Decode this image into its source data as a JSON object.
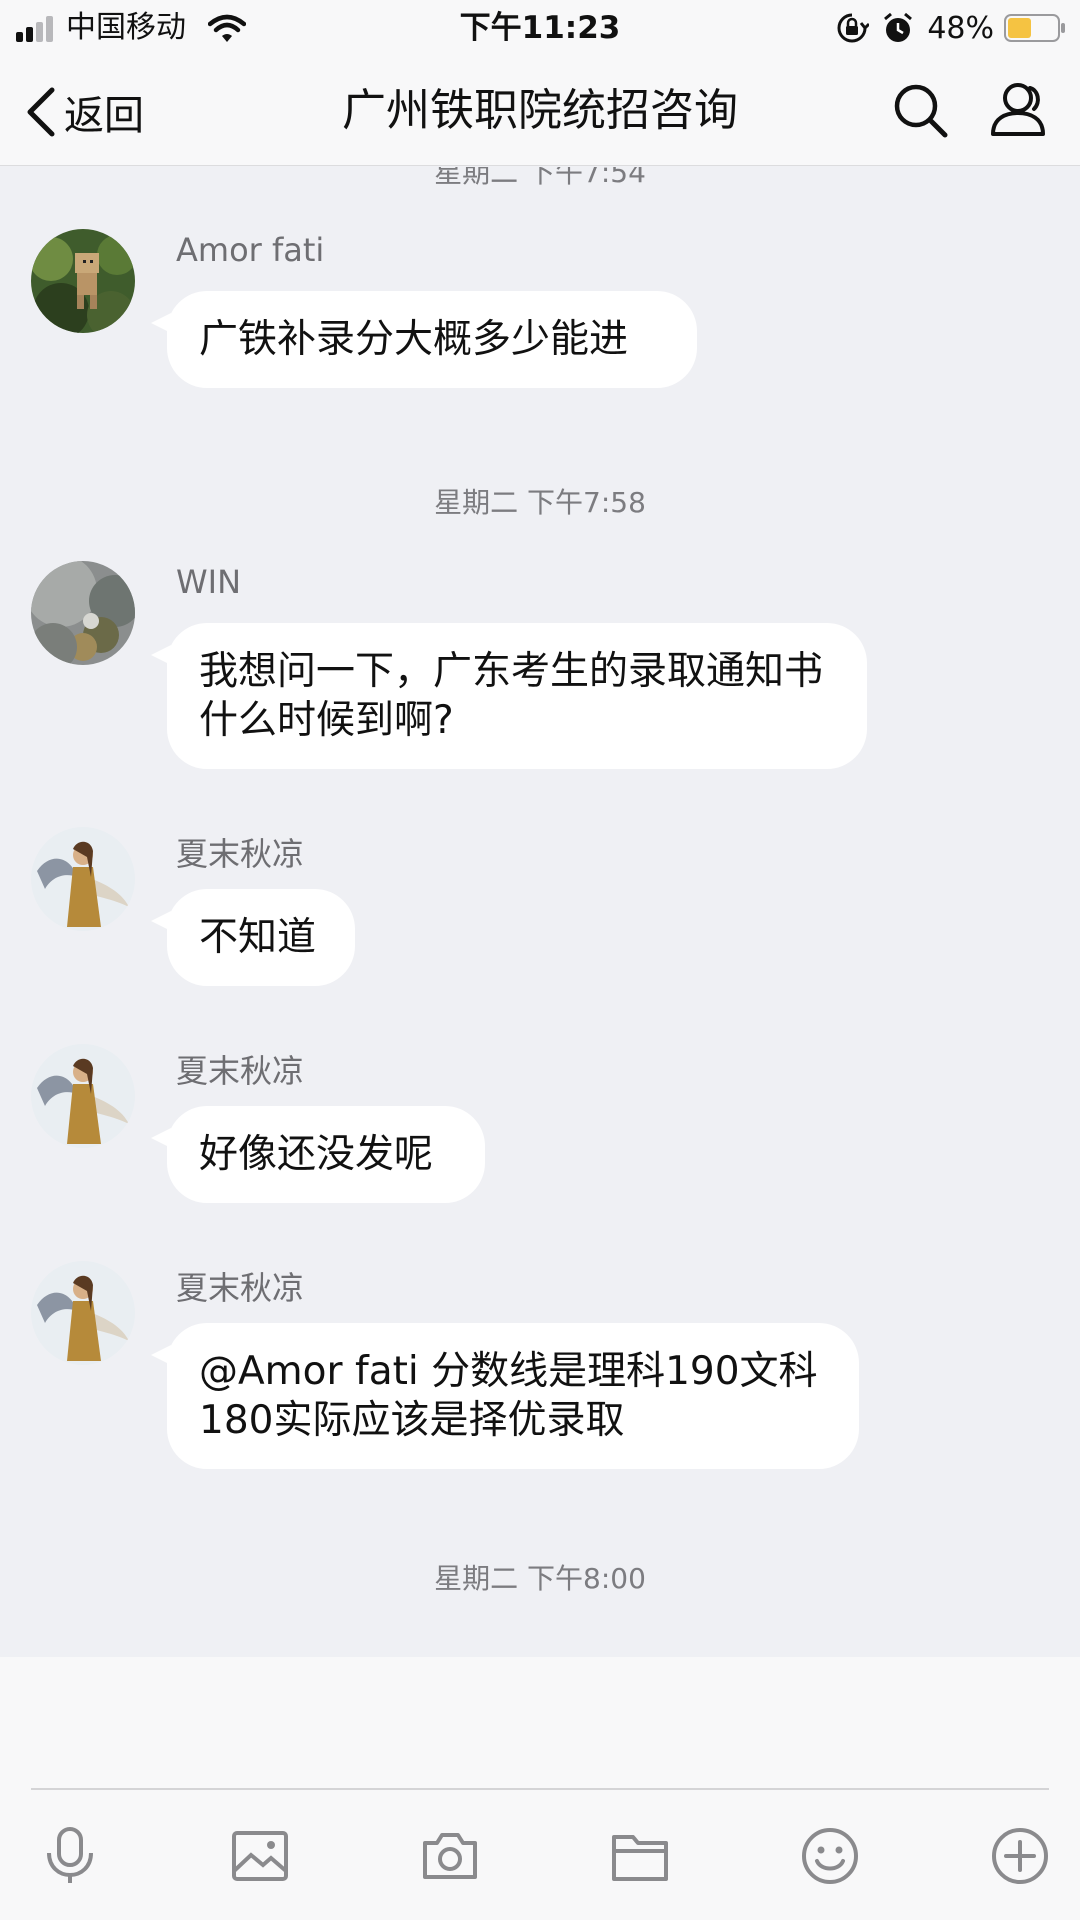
{
  "status_bar": {
    "carrier": "中国移动",
    "time": "下午11:23",
    "battery": "48%",
    "battery_level": 0.48,
    "battery_color": "#f5c342"
  },
  "nav": {
    "back_label": "返回",
    "title": "广州铁职院统招咨询",
    "search_icon": "search-icon",
    "profile_icon": "group-members-icon"
  },
  "chat": {
    "partial_timestamp": "星期二 下午7:54",
    "timestamp_1": "星期二 下午7:58",
    "timestamp_2": "星期二 下午8:00",
    "messages": [
      {
        "sender": "Amor fati",
        "text": "广铁补录分大概多少能进",
        "avatar": "avatar-figurine"
      },
      {
        "sender": "WIN",
        "text": "我想问一下，广东考生的录取通知书什么时候到啊?",
        "avatar": "avatar-landscape"
      },
      {
        "sender": "夏末秋凉",
        "text": "不知道",
        "avatar": "avatar-illustration"
      },
      {
        "sender": "夏末秋凉",
        "text": "好像还没发呢",
        "avatar": "avatar-illustration"
      },
      {
        "sender": "夏末秋凉",
        "text": "@Amor fati 分数线是理科190文科180实际应该是择优录取",
        "avatar": "avatar-illustration"
      }
    ]
  },
  "toolbar": {
    "icons": [
      "microphone-icon",
      "image-icon",
      "camera-icon",
      "folder-icon",
      "emoji-icon",
      "plus-icon"
    ]
  },
  "colors": {
    "chat_background": "#eff0f4",
    "bubble": "#ffffff",
    "bar_background": "#f8f8f9"
  }
}
